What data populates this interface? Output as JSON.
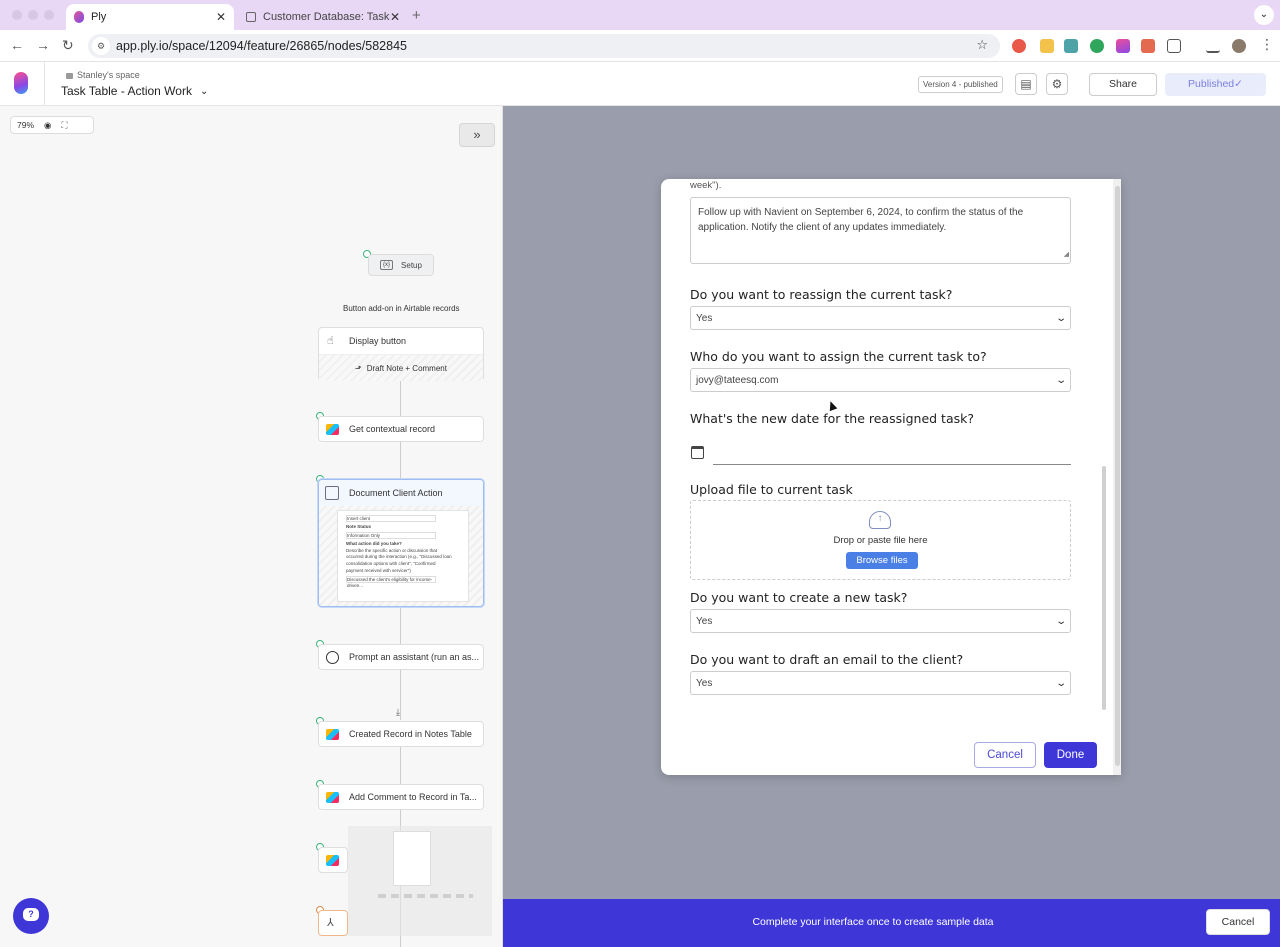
{
  "browser": {
    "tabs": [
      {
        "title": "Ply",
        "close": "✕"
      },
      {
        "title": "Customer Database: Tasks - /",
        "close": "✕"
      }
    ],
    "new_tab": "+",
    "url": "app.ply.io/space/12094/feature/26865/nodes/582845"
  },
  "header": {
    "space_name": "Stanley's space",
    "page_title": "Task Table - Action Work",
    "version": "Version 4 - published",
    "share_label": "Share",
    "published_label": "Published✓"
  },
  "canvas": {
    "zoom": "79%",
    "setup_label": "Setup",
    "group_label": "Button add-on in Airtable records",
    "display_button_label": "Display button",
    "draft_note_label": "Draft Note + Comment",
    "nodes": [
      "Get contextual record",
      "Document Client Action",
      "Prompt an assistant (run an as...",
      "Created Record in Notes Table",
      "Add Comment to Record in Ta..."
    ],
    "mini_form": {
      "line1": "Insert client",
      "note_status_label": "Note Status",
      "note_status_value": "Information Only",
      "question": "What action did you take?",
      "help1": "Describe the specific action or discussion that",
      "help2": "occurred during the interaction (e.g., \"Discussed loan",
      "help3": "consolidation options with client\", \"Confirmed",
      "help4": "payment received with servicer\")",
      "answer": "Discussed the client's eligibility for income-driven..."
    }
  },
  "form": {
    "cut_text": "week\").",
    "textarea_value": "Follow up with Navient on September 6, 2024, to confirm the status of the application. Notify the client of any updates immediately.",
    "q_reassign": "Do you want to reassign the current task?",
    "a_reassign": "Yes",
    "q_assignee": "Who do you want to assign the current task to?",
    "a_assignee": "jovy@tateesq.com",
    "q_newdate": "What's the new date for the reassigned task?",
    "q_upload": "Upload file to current task",
    "drop_text": "Drop or paste file here",
    "browse_label": "Browse files",
    "q_newtask": "Do you want to create a new task?",
    "a_newtask": "Yes",
    "q_email": "Do you want to draft an email to the client?",
    "a_email": "Yes",
    "cancel_label": "Cancel",
    "done_label": "Done"
  },
  "bottom_bar": {
    "message": "Complete your interface once to create sample data",
    "cancel_label": "Cancel"
  },
  "colors": {
    "accent": "#3f36d8",
    "tab_bar": "#e8d7f5",
    "preview_bg": "#9a9eac"
  }
}
